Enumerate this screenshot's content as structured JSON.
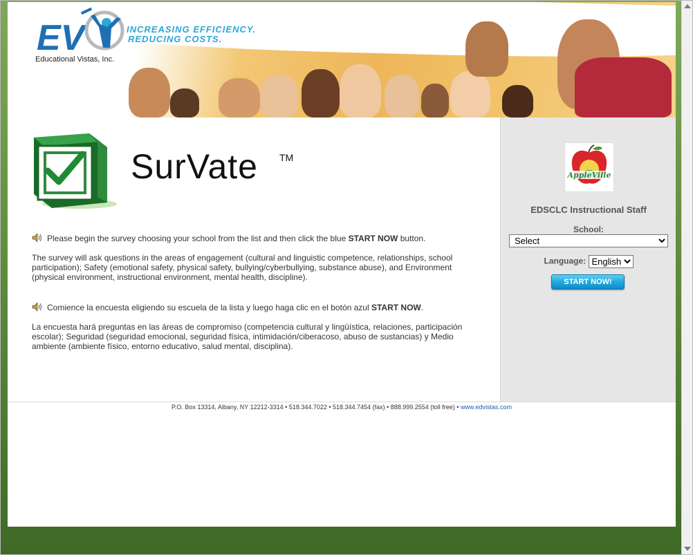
{
  "header": {
    "company_mark": "EV",
    "company_name": "Educational Vistas, Inc.",
    "tagline_line1": "INCREASING EFFICIENCY.",
    "tagline_line2": "REDUCING COSTS.",
    "product_name": "SurVate",
    "product_mark": "TM"
  },
  "intro_english": {
    "instruction_pre": "Please begin the survey choosing your school from the list and then click the blue ",
    "instruction_bold": "START NOW",
    "instruction_post": " button.",
    "description": "The survey will ask questions in the areas of engagement (cultural and linguistic competence, relationships, school participation); Safety (emotional safety, physical safety, bullying/cyberbullying, substance abuse), and Environment (physical environment, instructional environment, mental health, discipline)."
  },
  "intro_spanish": {
    "instruction_pre": "Comience la encuesta eligiendo su escuela de la lista y luego haga clic en el botón azul ",
    "instruction_bold": "START NOW",
    "instruction_post": ".",
    "description": "La encuesta hará preguntas en las áreas de compromiso (competencia cultural y lingüística, relaciones, participación escolar); Seguridad (seguridad emocional, seguridad física, intimidación/ciberacoso, abuso de sustancias) y Medio ambiente (ambiente físico, entorno educativo, salud mental, disciplina)."
  },
  "sidebar": {
    "school_logo_text": "AppleVille",
    "staff_title": "EDSCLC Instructional Staff",
    "school_label": "School:",
    "school_selected": "Select",
    "language_label": "Language:",
    "language_selected": "English",
    "start_button": "START NOW!"
  },
  "footer": {
    "address": "P.O. Box 13314, Albany, NY 12212-3314 • 518.344.7022 • 518.344.7454 (fax) • 888.999.2554 (toll free) • ",
    "link": "www.edvistas.com"
  },
  "colors": {
    "accent_blue": "#21a8de",
    "frame_green": "#5f8a3d",
    "banner_orange": "#eeb658"
  }
}
